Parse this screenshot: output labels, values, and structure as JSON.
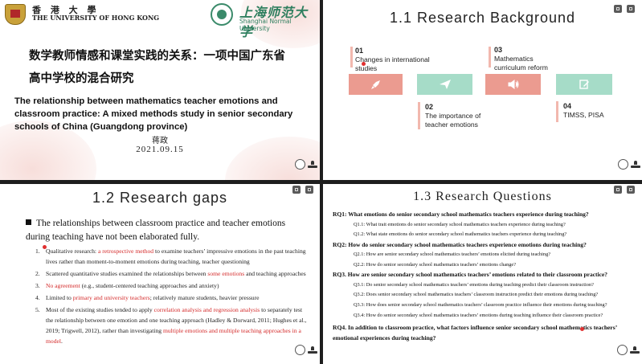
{
  "slide1": {
    "hku_cn": "香 港 大 學",
    "hku_en": "THE UNIVERSITY OF HONG KONG",
    "shnu_cn": "上海师范大学",
    "shnu_en": "Shanghai Normal University",
    "title_cn": "数学教师情感和课堂实践的关系：一项中国广东省高中学校的混合研究",
    "title_en": "The relationship between mathematics teacher emotions and classroom practice: A mixed methods study in senior secondary schools of China (Guangdong province)",
    "author": "蒋政",
    "date": "2021.09.15"
  },
  "slide2": {
    "title": "1.1 Research Background",
    "items": [
      {
        "num": "01",
        "text": "Changes in international studies"
      },
      {
        "num": "02",
        "text": "The importance of teacher emotions"
      },
      {
        "num": "03",
        "text": "Mathematics curriculum reform"
      },
      {
        "num": "04",
        "text": "TIMSS, PISA"
      }
    ],
    "icons": [
      "rocket-icon",
      "paper-plane-icon",
      "speaker-icon",
      "edit-icon"
    ],
    "colors": {
      "pink": "#eb9b90",
      "green": "#a6dcc8",
      "accent_bar": "#f2b8ae"
    }
  },
  "slide3": {
    "title": "1.2 Research gaps",
    "bullet": "The relationships between classroom practice and teacher emotions during teaching have not been elaborated fully.",
    "items": [
      {
        "n": "1.",
        "pre": "Qualitative research: ",
        "red": "a retrospective method",
        "post": " to examine teachers’ impressive emotions in the past teaching lives rather than moment-to-moment emotions during teaching, teacher questioning"
      },
      {
        "n": "2.",
        "pre": "Scattered quantitative studies examined the relationships between ",
        "red": "some emotions",
        "post": " and teaching approaches"
      },
      {
        "n": "3.",
        "pre": "",
        "red": "No agreement",
        "post": " (e.g., student-centered teaching approaches and anxiety)"
      },
      {
        "n": "4.",
        "pre": "Limited to ",
        "red": "primary and university teachers",
        "post": "; relatively mature students, heavier pressure"
      },
      {
        "n": "5.",
        "pre": "Most of the existing studies tended to apply ",
        "red": "correlation analysis and regression analysis",
        "post": " to separately test the relationship between one emotion and one teaching approach (Hadley & Dorward, 2011; Hughes et al., 2019; Trigwell, 2012), rather than investigating ",
        "red2": "multiple emotions and multiple teaching approaches in a model",
        "post2": "."
      }
    ]
  },
  "slide4": {
    "title": "1.3 Research Questions",
    "rq1": "RQ1: What emotions do senior secondary school mathematics teachers experience during teaching?",
    "q1_1": "Q1.1: What trait emotions do senior secondary school mathematics teachers experience during teaching?",
    "q1_2": "Q1.2: What state emotions do senior secondary school mathematics teachers experience during teaching?",
    "rq2": "RQ2: How do senior secondary school mathematics teachers experience emotions during teaching?",
    "q2_1": "Q2.1: How are senior secondary school mathematics teachers’ emotions elicited during teaching?",
    "q2_2": "Q2.2: How do senior secondary school mathematics teachers’ emotions change?",
    "rq3": "RQ3. How are senior secondary school mathematics teachers’ emotions related to their classroom practice?",
    "q3_1": "Q3.1: Do senior secondary school mathematics teachers’ emotions during teaching predict their classroom instruction?",
    "q3_2": "Q3.2: Does senior secondary school mathematics teachers’ classroom instruction predict their emotions during teaching?",
    "q3_3": "Q3.3: How does senior secondary school mathematics teachers’ classroom practice influence their emotions during teaching?",
    "q3_4": "Q3.4: How do senior secondary school mathematics teachers’ emotions during teaching influence their classroom practice?",
    "rq4": "RQ4. In addition to classroom practice, what factors influence senior secondary school mathematics teachers’ emotional experiences during teaching?"
  }
}
